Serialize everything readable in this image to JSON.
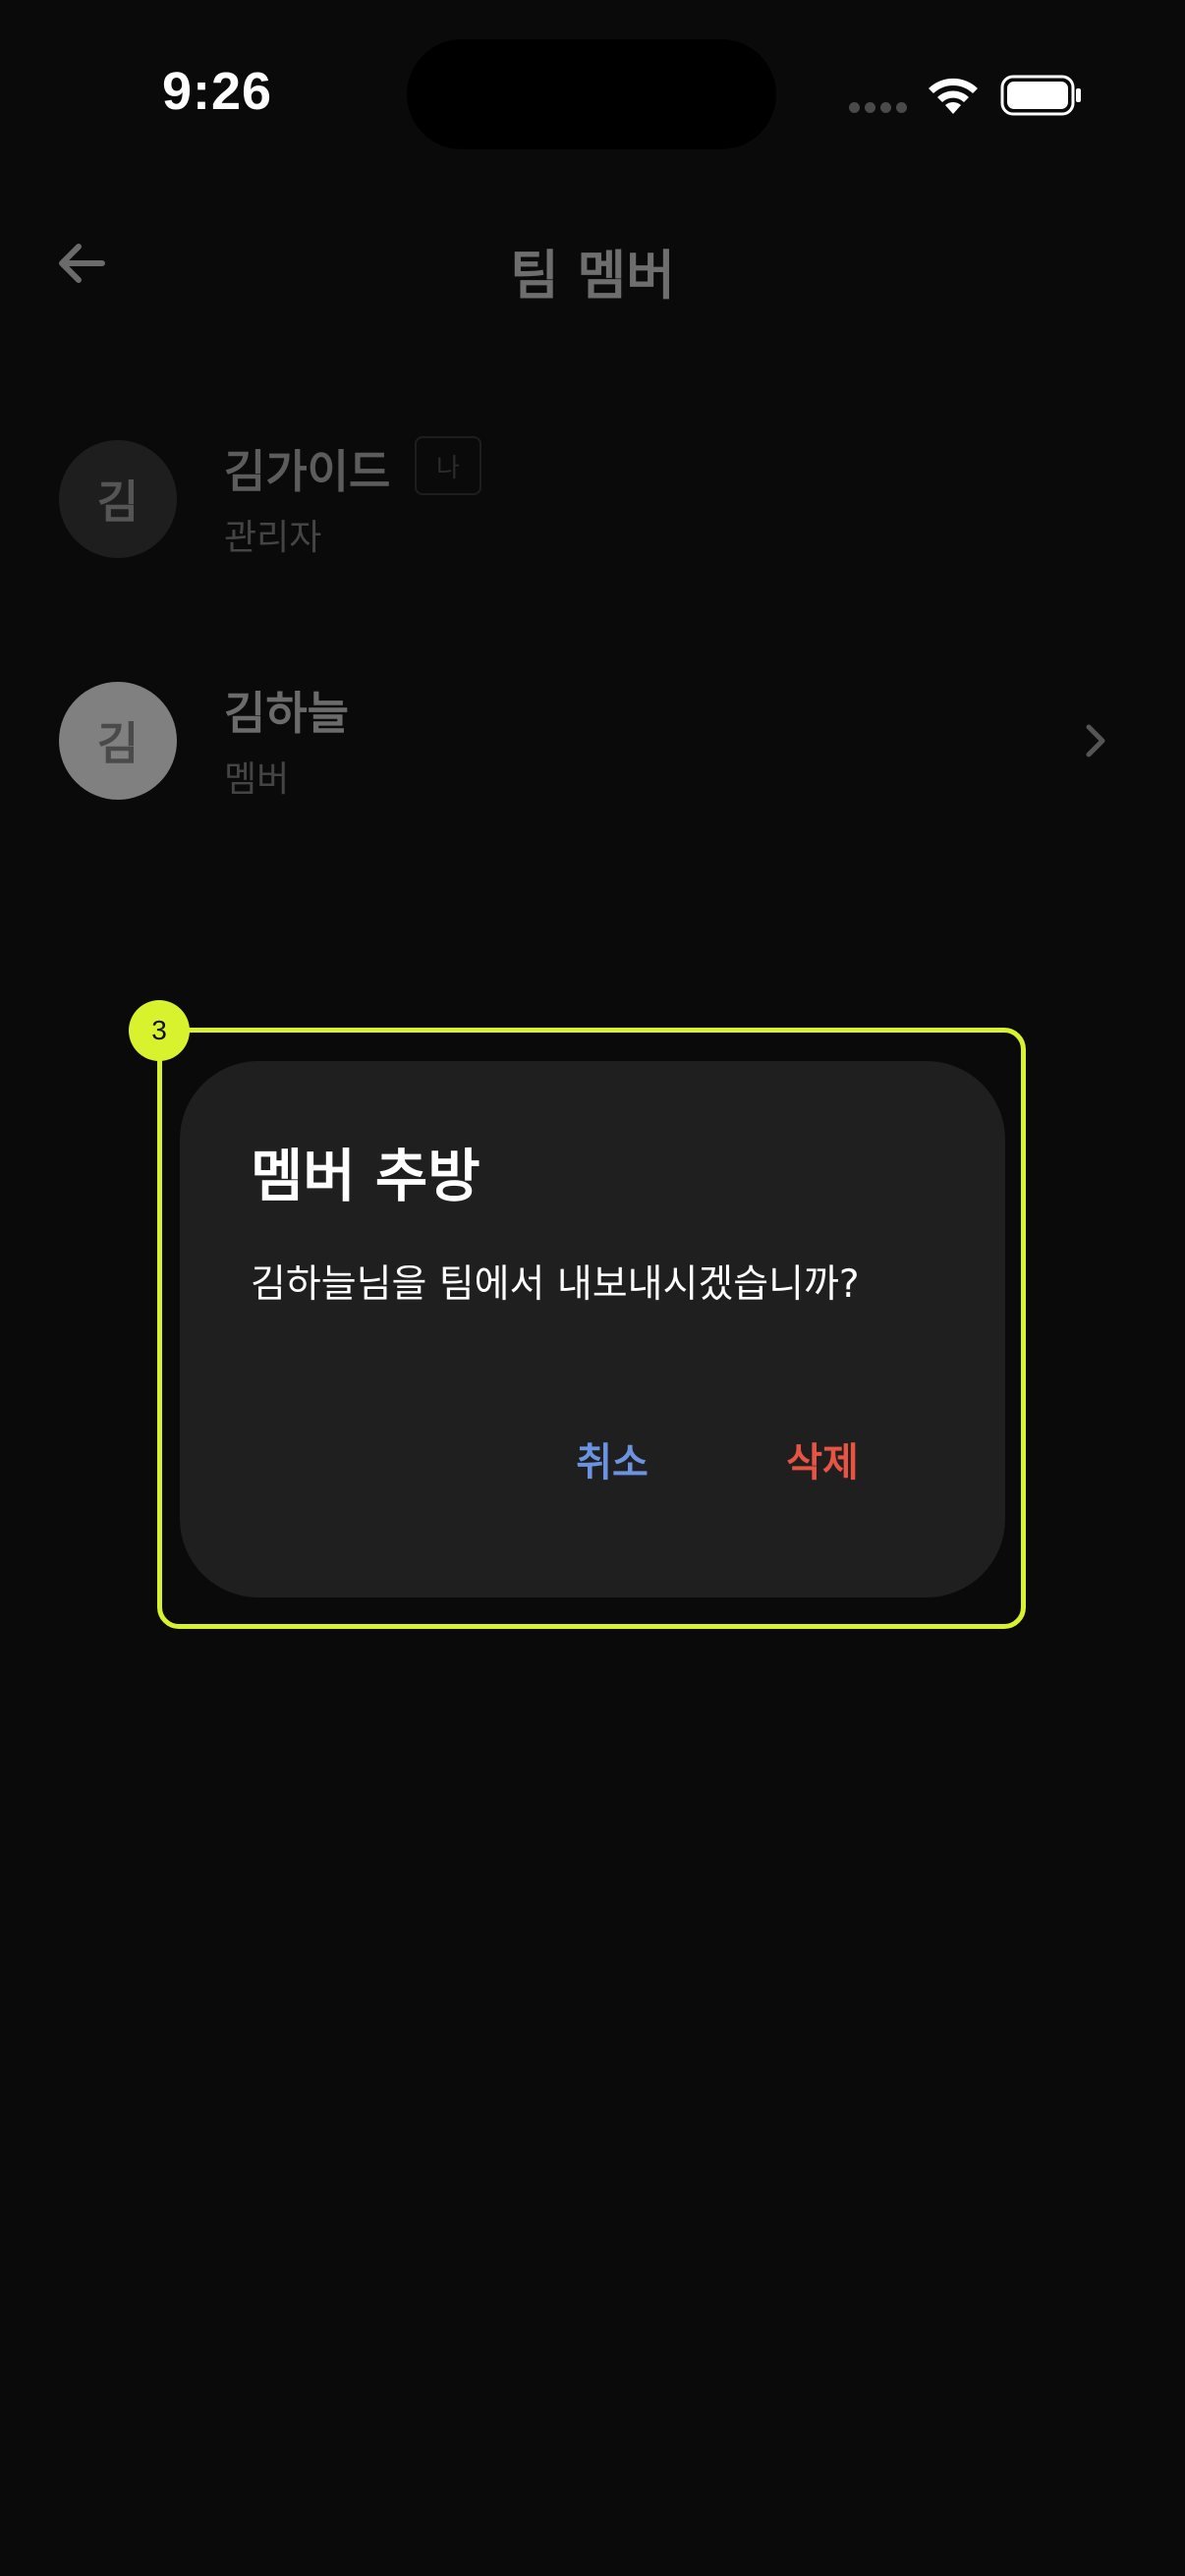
{
  "status_bar": {
    "time": "9:26"
  },
  "header": {
    "title": "팀 멤버",
    "back_icon": "arrow-left-icon"
  },
  "members": [
    {
      "avatar": "김",
      "name": "김가이드",
      "role": "관리자",
      "badge": "나"
    },
    {
      "avatar": "김",
      "name": "김하늘",
      "role": "멤버"
    }
  ],
  "annotation": {
    "step": "3",
    "color": "#d8f32d"
  },
  "dialog": {
    "title": "멤버 추방",
    "message": "김하늘님을 팀에서 내보내시겠습니까?",
    "cancel_label": "취소",
    "delete_label": "삭제",
    "cancel_color": "#6b93e0",
    "delete_color": "#e85444"
  }
}
